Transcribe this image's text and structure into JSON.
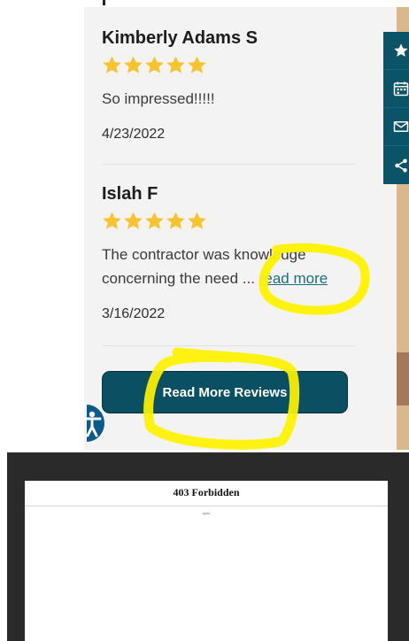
{
  "reviews": [
    {
      "name": "Kimberly Adams S",
      "rating": 5,
      "text": "So impressed!!!!!",
      "date": "4/23/2022"
    },
    {
      "name": "Islah F",
      "rating": 5,
      "text_line1": "The contractor was knowledge",
      "text_line2": "concerning the need ...",
      "read_more": "read more",
      "date": "3/16/2022"
    }
  ],
  "more_reviews_button": "Read More Reviews",
  "toolbar": {
    "icons": [
      "star-icon",
      "calendar-icon",
      "mail-icon",
      "share-icon"
    ]
  },
  "accessibility_icon": "accessibility-icon",
  "error_page": {
    "title": "403 Forbidden",
    "server": "nginx"
  },
  "colors": {
    "star": "#f7c331",
    "button": "#0a4f62",
    "link": "#1b6e7e",
    "toolbar": "#0b5367",
    "highlight": "#fff200"
  }
}
